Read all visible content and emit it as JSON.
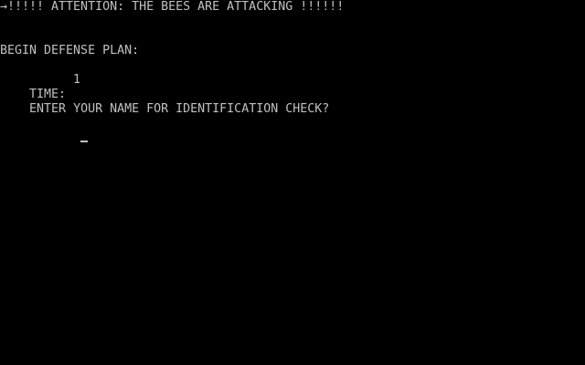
{
  "header": {
    "attention_text": "→!!!!! ATTENTION: THE BEES ARE ATTACKING !!!!!!"
  },
  "defense": {
    "heading": "BEGIN DEFENSE PLAN:"
  },
  "status": {
    "time_label": "TIME:",
    "time_value": "1"
  },
  "prompt": {
    "text": "ENTER YOUR NAME FOR IDENTIFICATION CHECK?",
    "input_value": ""
  },
  "colors": {
    "background": "#000000",
    "text": "#c0c0c0"
  }
}
